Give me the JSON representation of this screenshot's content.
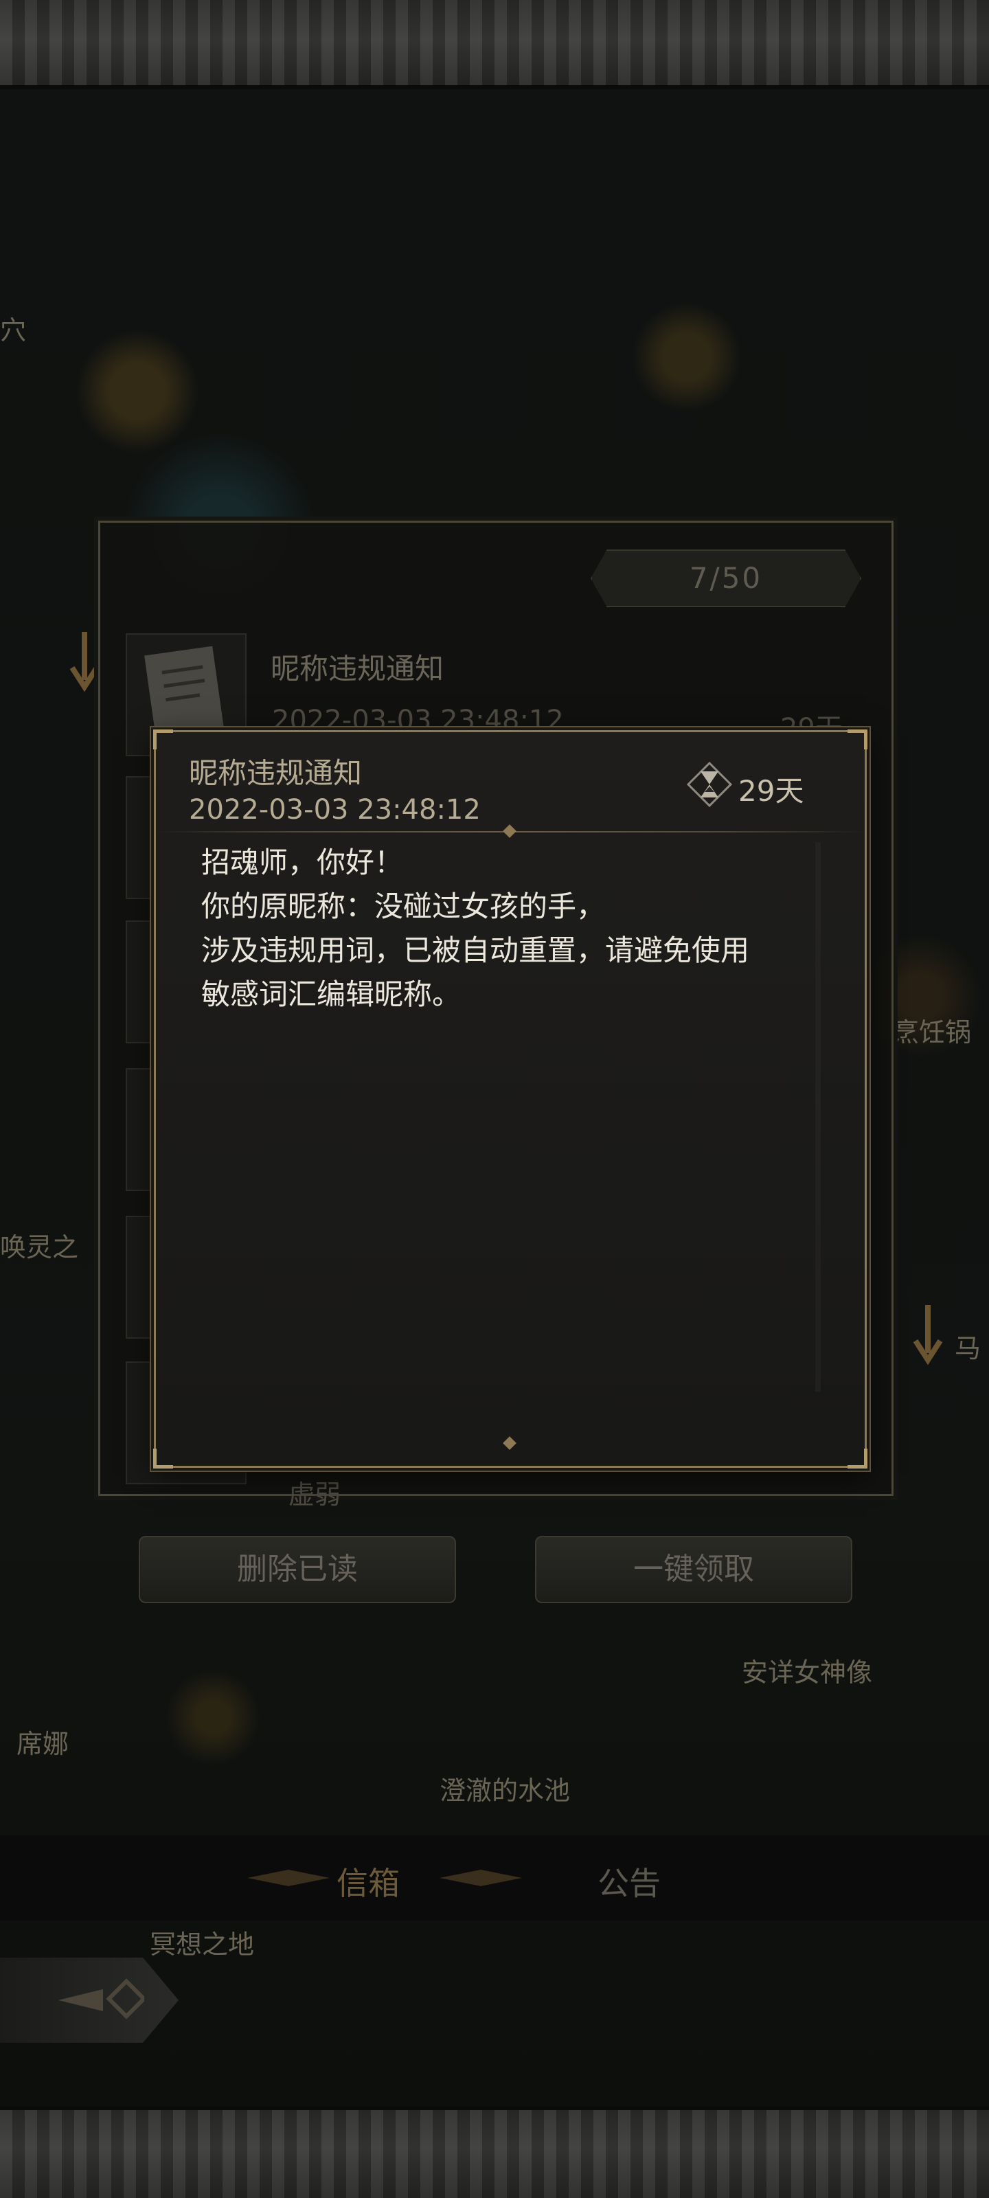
{
  "background": {
    "labels": [
      "穴",
      "唤灵之",
      "烹饪锅",
      "马",
      "安详女神像",
      "席娜",
      "澄澈的水池",
      "冥想之地"
    ]
  },
  "mail_panel": {
    "count": "7/50",
    "first_item": {
      "title": "昵称违规通知",
      "time": "2022-03-03 23:48:12",
      "days": "29天"
    },
    "bottom_label": "虚弱",
    "delete_read_label": "删除已读",
    "claim_all_label": "一键领取"
  },
  "tabs": {
    "inbox": "信箱",
    "notice": "公告"
  },
  "message": {
    "title": "昵称违规通知",
    "time": "2022-03-03 23:48:12",
    "remaining": "29天",
    "lines": [
      "招魂师，你好！",
      "你的原昵称：没碰过女孩的手，",
      "涉及违规用词，已被自动重置，请避免使用",
      "敏感词汇编辑昵称。"
    ]
  },
  "colors": {
    "accent_gold": "#8d7a55",
    "text_light": "#ece7dc",
    "text_muted": "#b6ab93"
  },
  "icons": [
    "hourglass-icon",
    "back-arrow-icon",
    "arrow-down-icon"
  ]
}
